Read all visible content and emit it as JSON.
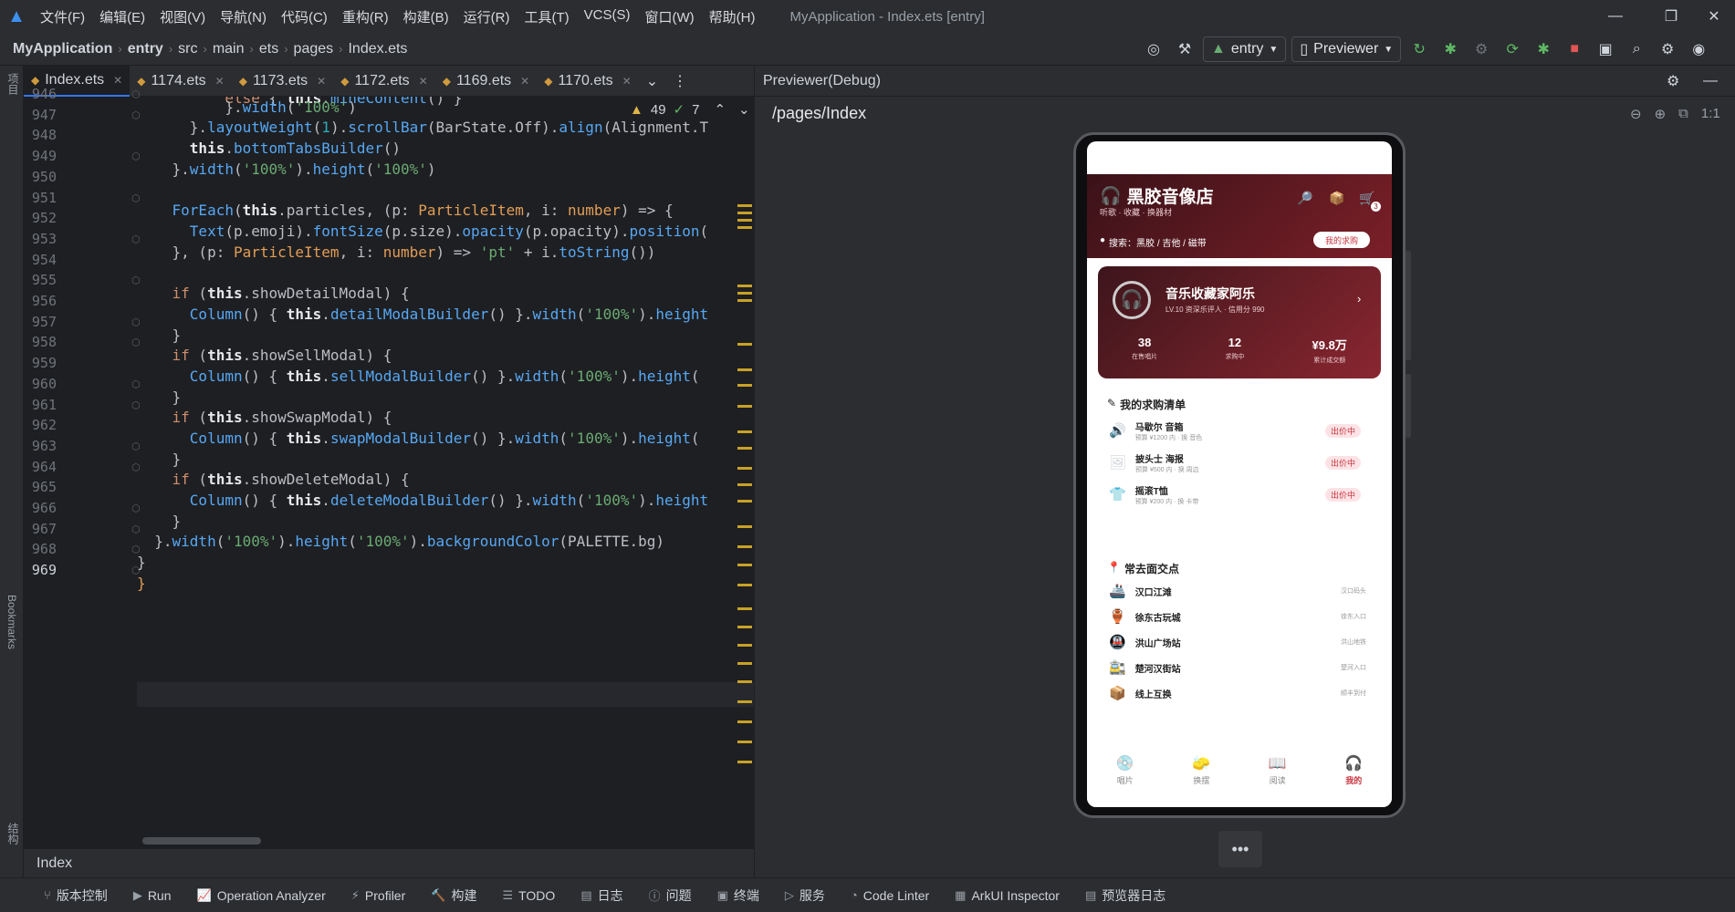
{
  "menu": [
    "文件(F)",
    "编辑(E)",
    "视图(V)",
    "导航(N)",
    "代码(C)",
    "重构(R)",
    "构建(B)",
    "运行(R)",
    "工具(T)",
    "VCS(S)",
    "窗口(W)",
    "帮助(H)"
  ],
  "window_title": "MyApplication - Index.ets [entry]",
  "breadcrumb": [
    "MyApplication",
    "entry",
    "src",
    "main",
    "ets",
    "pages",
    "Index.ets"
  ],
  "toolbar": {
    "module": "entry",
    "device": "Previewer"
  },
  "tabs": [
    "Index.ets",
    "1174.ets",
    "1173.ets",
    "1172.ets",
    "1169.ets",
    "1170.ets"
  ],
  "inspections": {
    "warnings": "49",
    "weak": "7"
  },
  "line_numbers": [
    "946",
    "947",
    "948",
    "949",
    "950",
    "951",
    "952",
    "953",
    "954",
    "955",
    "956",
    "957",
    "958",
    "959",
    "960",
    "961",
    "962",
    "963",
    "964",
    "965",
    "966",
    "967",
    "968",
    "969"
  ],
  "status_file": "Index",
  "previewer": {
    "title": "Previewer(Debug)",
    "path": "/pages/Index"
  },
  "left_strip": {
    "project": "项目",
    "bookmarks": "Bookmarks",
    "structure": "结构"
  },
  "bottom_bar": [
    "版本控制",
    "Run",
    "Operation Analyzer",
    "Profiler",
    "构建",
    "TODO",
    "日志",
    "问题",
    "终端",
    "服务",
    "Code Linter",
    "ArkUI Inspector",
    "预览器日志"
  ],
  "app": {
    "shop_name": "黑胶音像店",
    "shop_sub": "听歌 · 收藏 · 换器材",
    "search_text": "搜索：黑胶 / 吉他 / 磁带",
    "my_requests_btn": "我的求购",
    "cart_count": "3",
    "profile": {
      "name": "音乐收藏家阿乐",
      "desc": "LV.10 资深乐评人 · 信用分 990"
    },
    "stats": [
      {
        "value": "38",
        "label": "在售唱片"
      },
      {
        "value": "12",
        "label": "求购中"
      },
      {
        "value": "¥9.8万",
        "label": "累计成交额"
      }
    ],
    "wishlist_title": "我的求购清单",
    "wishlist": [
      {
        "name": "马歇尔 音箱",
        "sub": "预算 ¥1200 内 · 换 音色",
        "status": "出价中",
        "icon": "speaker-icon"
      },
      {
        "name": "披头士 海报",
        "sub": "预算 ¥500 内 · 换 周边",
        "status": "出价中",
        "icon": "poster-icon"
      },
      {
        "name": "摇滚T恤",
        "sub": "预算 ¥200 内 · 换 卡带",
        "status": "出价中",
        "icon": "tshirt-icon"
      }
    ],
    "spots_title": "常去面交点",
    "spots": [
      {
        "name": "汉口江滩",
        "tag": "汉口码头"
      },
      {
        "name": "徐东古玩城",
        "tag": "徐东入口"
      },
      {
        "name": "洪山广场站",
        "tag": "洪山地铁"
      },
      {
        "name": "楚河汉街站",
        "tag": "楚河入口"
      },
      {
        "name": "线上互换",
        "tag": "顺丰到付"
      }
    ],
    "nav": [
      {
        "label": "唱片",
        "icon": "disc-icon"
      },
      {
        "label": "换摆",
        "icon": "swap-icon"
      },
      {
        "label": "阅读",
        "icon": "book-icon"
      },
      {
        "label": "我的",
        "icon": "headphone-icon"
      }
    ]
  },
  "colors": {
    "accent": "#3574f0",
    "brand": "#7b1f28",
    "warn": "#e0b34a"
  }
}
